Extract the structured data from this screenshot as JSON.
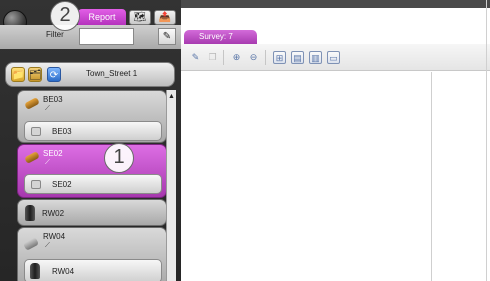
{
  "header": {
    "report_tab": "Report",
    "tool_tab_1_icon": "globe-map-icon",
    "tool_tab_2_icon": "export-icon"
  },
  "filter": {
    "label": "Filter",
    "value": "",
    "action_icon": "filter-edit-icon"
  },
  "tree": {
    "root_label": "Town_Street 1",
    "root_icons": [
      "folder-icon",
      "map-folder-icon",
      "refresh-icon"
    ]
  },
  "items": [
    {
      "label": "BE03",
      "sub": "BE03",
      "icon": "pipe-orange-icon",
      "selected": false
    },
    {
      "label": "SE02",
      "sub": "SE02",
      "icon": "pipe-orange-icon",
      "selected": true
    },
    {
      "label": "RW02",
      "icon": "bollard-icon",
      "selected": false
    },
    {
      "label": "RW04",
      "sub": "RW04",
      "icon": "pipe-gray-icon",
      "sub_icon": "bollard-icon",
      "selected": false
    }
  ],
  "survey": {
    "tab_label": "Survey: 7"
  },
  "toolbar": {
    "buttons": [
      "pen-icon",
      "copy-icon",
      "zoom-in-icon",
      "zoom-out-icon",
      "grid-icon",
      "grid-split-icon",
      "columns-icon",
      "page-icon"
    ]
  },
  "callouts": [
    "1",
    "2"
  ],
  "colors": {
    "accent_magenta": "#c040c8",
    "panel_dark": "#2c2c2c"
  }
}
